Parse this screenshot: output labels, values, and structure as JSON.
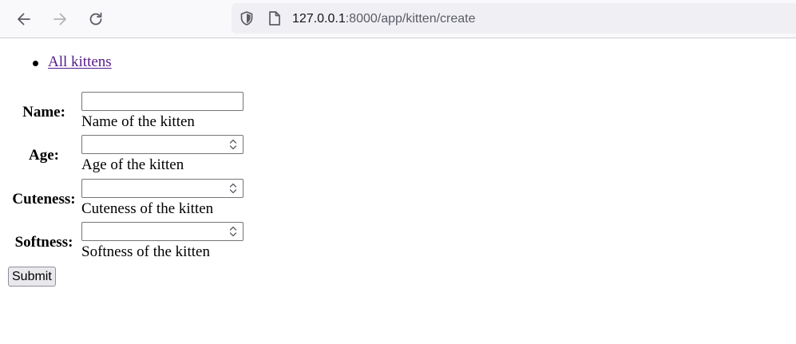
{
  "browser": {
    "url_host": "127.0.0.1",
    "url_path": ":8000/app/kitten/create",
    "icons": {
      "back": "back-arrow-icon",
      "forward": "forward-arrow-icon",
      "reload": "reload-icon",
      "security": "shield-icon",
      "page": "page-icon"
    }
  },
  "nav": {
    "links": [
      {
        "label": "All kittens"
      }
    ]
  },
  "form": {
    "fields": [
      {
        "label": "Name:",
        "value": "",
        "help": "Name of the kitten",
        "type": "text"
      },
      {
        "label": "Age:",
        "value": "",
        "help": "Age of the kitten",
        "type": "number"
      },
      {
        "label": "Cuteness:",
        "value": "",
        "help": "Cuteness of the kitten",
        "type": "number"
      },
      {
        "label": "Softness:",
        "value": "",
        "help": "Softness of the kitten",
        "type": "number"
      }
    ],
    "submit_label": "Submit"
  },
  "colors": {
    "visited_link": "#551a8b",
    "toolbar_bg": "#f9f9fb",
    "urlbar_bg": "#f0f0f4"
  }
}
